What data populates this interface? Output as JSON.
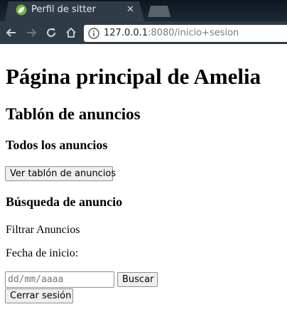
{
  "browser": {
    "tab_title": "Perfil de sitter",
    "tab_close_glyph": "✕",
    "favicon": "leaf-icon",
    "url_host": "127.0.0.1",
    "url_rest": ":8080/inicio+sesion"
  },
  "page": {
    "title": "Página principal de Amelia",
    "section_title": "Tablón de anuncios",
    "all_ads_heading": "Todos los anuncios",
    "view_board_button": "Ver tablón de anuncios",
    "search_heading": "Búsqueda de anuncio",
    "filter_text": "Filtrar Anuncios",
    "start_date_label": "Fecha de inicio:",
    "date_placeholder": "dd/mm/aaaa",
    "search_button": "Buscar",
    "logout_button": "Cerrar sesión"
  },
  "colors": {
    "chrome_dark": "#1f2a36",
    "toolbar": "#2f3b47",
    "favicon_green": "#8bc34a"
  }
}
